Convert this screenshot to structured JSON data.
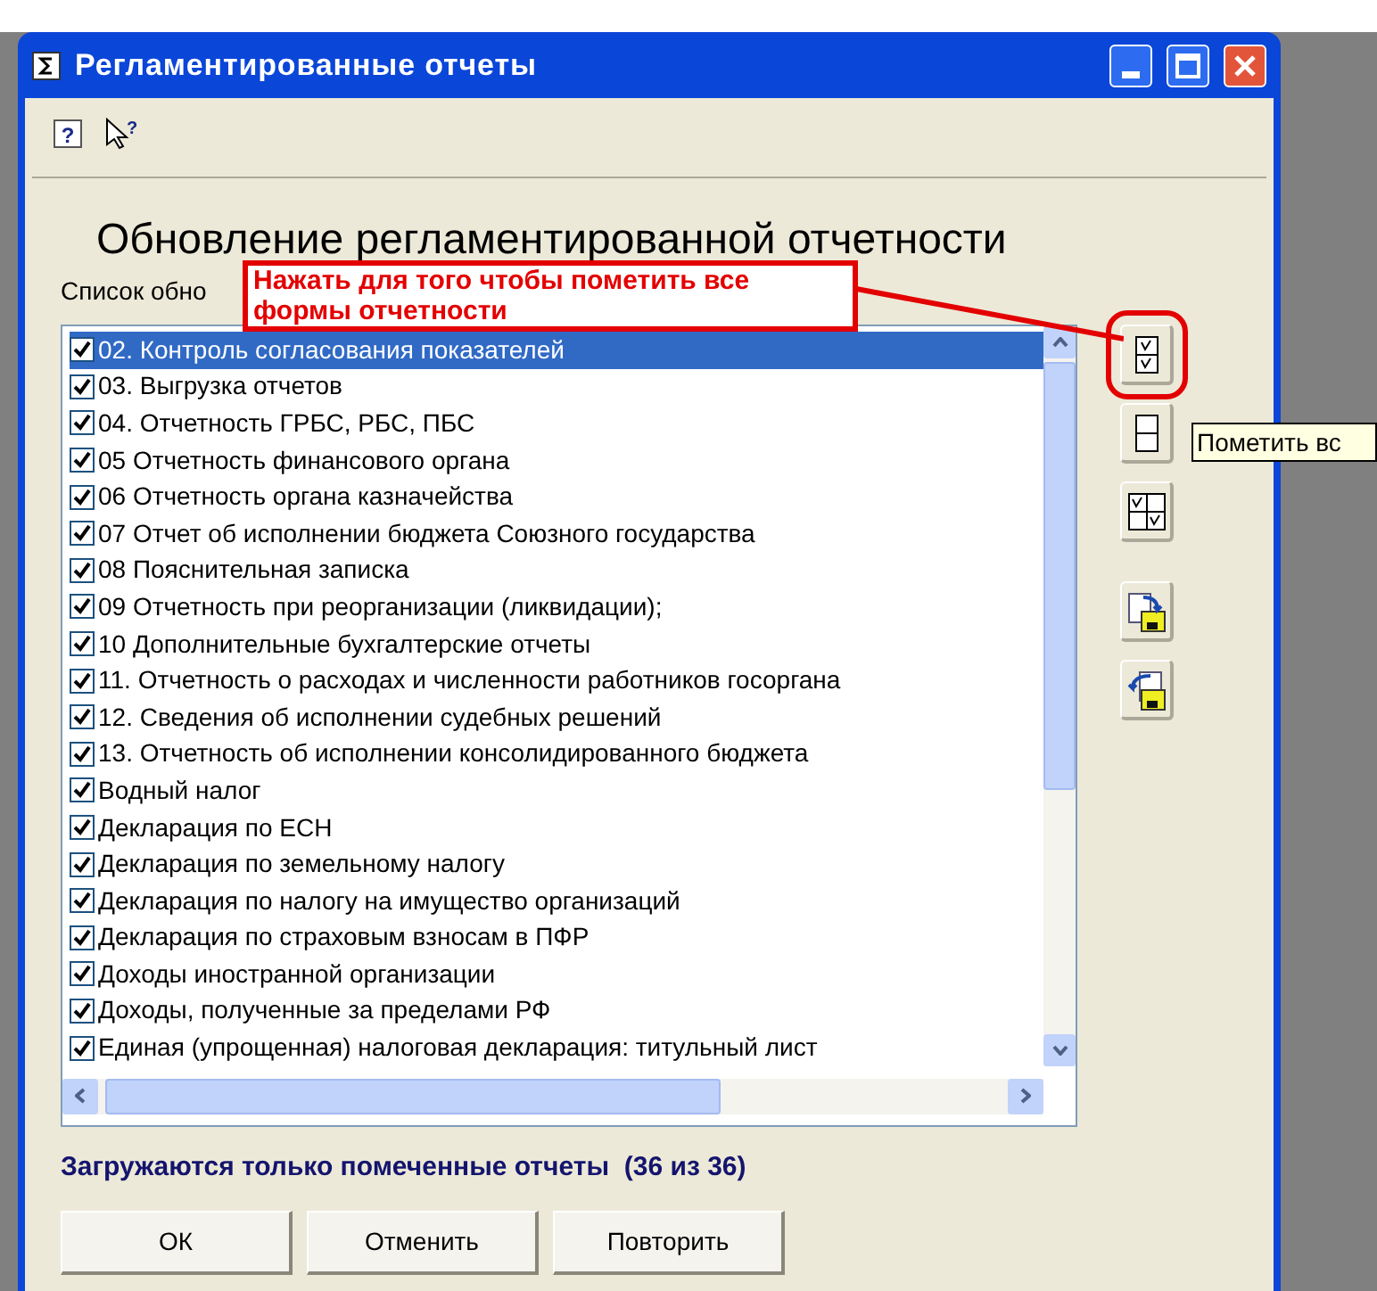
{
  "window": {
    "title": "Регламентированные отчеты"
  },
  "toolbar": [
    {
      "kind": "help",
      "glyph": "?"
    },
    {
      "kind": "pointer-help",
      "glyph": "?"
    }
  ],
  "heading": "Обновление регламентированной отчетности",
  "list_label": "Список обно",
  "callout": {
    "text": "Нажать для того чтобы пометить все формы отчетности"
  },
  "reports": [
    {
      "label": "02. Контроль согласования показателей",
      "checked": true,
      "selected": true
    },
    {
      "label": "03. Выгрузка отчетов",
      "checked": true,
      "selected": false
    },
    {
      "label": "04. Отчетность ГРБС, РБС, ПБС",
      "checked": true,
      "selected": false
    },
    {
      "label": "05 Отчетность финансового органа",
      "checked": true,
      "selected": false
    },
    {
      "label": "06 Отчетность органа казначейства",
      "checked": true,
      "selected": false
    },
    {
      "label": "07 Отчет об исполнении бюджета Союзного государства",
      "checked": true,
      "selected": false
    },
    {
      "label": "08 Пояснительная записка",
      "checked": true,
      "selected": false
    },
    {
      "label": "09 Отчетность при реорганизации (ликвидации);",
      "checked": true,
      "selected": false
    },
    {
      "label": "10 Дополнительные бухгалтерские отчеты",
      "checked": true,
      "selected": false
    },
    {
      "label": "11. Отчетность о расходах и численности работников госоргана",
      "checked": true,
      "selected": false
    },
    {
      "label": "12. Сведения об исполнении судебных решений",
      "checked": true,
      "selected": false
    },
    {
      "label": "13. Отчетность об исполнении консолидированного бюджета",
      "checked": true,
      "selected": false
    },
    {
      "label": "Водный налог",
      "checked": true,
      "selected": false
    },
    {
      "label": "Декларация по ЕСН",
      "checked": true,
      "selected": false
    },
    {
      "label": "Декларация по земельному налогу",
      "checked": true,
      "selected": false
    },
    {
      "label": "Декларация по налогу на имущество организаций",
      "checked": true,
      "selected": false
    },
    {
      "label": "Декларация по страховым взносам в ПФР",
      "checked": true,
      "selected": false
    },
    {
      "label": "Доходы иностранной организации",
      "checked": true,
      "selected": false
    },
    {
      "label": "Доходы, полученные за пределами РФ",
      "checked": true,
      "selected": false
    },
    {
      "label": "Единая (упрощенная) налоговая декларация: титульный лист",
      "checked": true,
      "selected": false
    }
  ],
  "side_buttons": [
    {
      "kind": "check-all",
      "highlighted": true
    },
    {
      "kind": "uncheck-all",
      "highlighted": false
    },
    {
      "kind": "invert",
      "highlighted": false
    },
    {
      "kind": "load",
      "highlighted": false
    },
    {
      "kind": "save",
      "highlighted": false
    }
  ],
  "tooltip": "Пометить вс",
  "status": "Загружаются только помеченные отчеты  (36 из 36)",
  "buttons": [
    "ОК",
    "Отменить",
    "Повторить"
  ]
}
